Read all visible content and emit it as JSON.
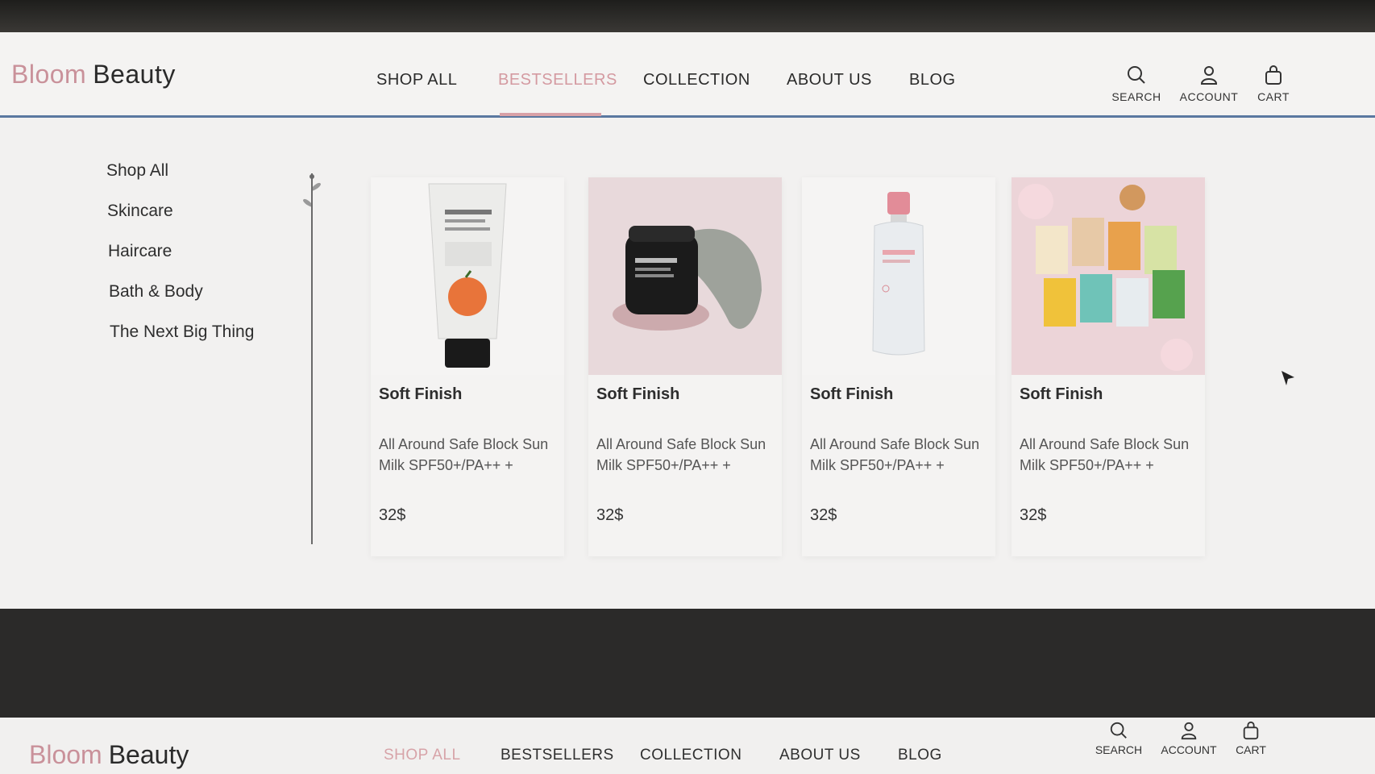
{
  "brand": {
    "part1": "Bloom",
    "part2": "Beauty"
  },
  "nav": {
    "items": [
      {
        "label": "SHOP ALL"
      },
      {
        "label": "BESTSELLERS"
      },
      {
        "label": "COLLECTION"
      },
      {
        "label": "ABOUT US"
      },
      {
        "label": "BLOG"
      }
    ],
    "active_index": 1
  },
  "header_icons": {
    "search": {
      "label": "SEARCH",
      "icon": "search-icon"
    },
    "account": {
      "label": "ACCOUNT",
      "icon": "user-icon"
    },
    "cart": {
      "label": "CART",
      "icon": "bag-icon"
    }
  },
  "sidebar": {
    "items": [
      {
        "label": "Shop All"
      },
      {
        "label": "Skincare"
      },
      {
        "label": "Haircare"
      },
      {
        "label": "Bath & Body"
      },
      {
        "label": "The Next Big Thing"
      }
    ]
  },
  "products": [
    {
      "name": "Soft Finish",
      "description": "All Around Safe Block Sun Milk SPF50+/PA++ +",
      "price": "32$",
      "image": "cleanser-tube"
    },
    {
      "name": "Soft Finish",
      "description": "All Around Safe Block Sun Milk SPF50+/PA++ +",
      "price": "32$",
      "image": "clay-mask-jar"
    },
    {
      "name": "Soft Finish",
      "description": "All Around Safe Block Sun Milk SPF50+/PA++ +",
      "price": "32$",
      "image": "cleansing-water-bottle"
    },
    {
      "name": "Soft Finish",
      "description": "All Around Safe Block Sun Milk SPF50+/PA++ +",
      "price": "32$",
      "image": "sheet-mask-collection"
    }
  ],
  "bottom_header": {
    "brand": {
      "part1": "Bloom",
      "part2": "Beauty"
    },
    "nav": [
      {
        "label": "SHOP ALL"
      },
      {
        "label": "BESTSELLERS"
      },
      {
        "label": "COLLECTION"
      },
      {
        "label": "ABOUT US"
      },
      {
        "label": "BLOG"
      }
    ],
    "active_index": 0,
    "icons": {
      "search": {
        "label": "SEARCH"
      },
      "account": {
        "label": "ACCOUNT"
      },
      "cart": {
        "label": "CART"
      }
    }
  },
  "colors": {
    "accent": "#d49aa1",
    "divider": "#5a78a0",
    "text": "#2b2b2b"
  }
}
